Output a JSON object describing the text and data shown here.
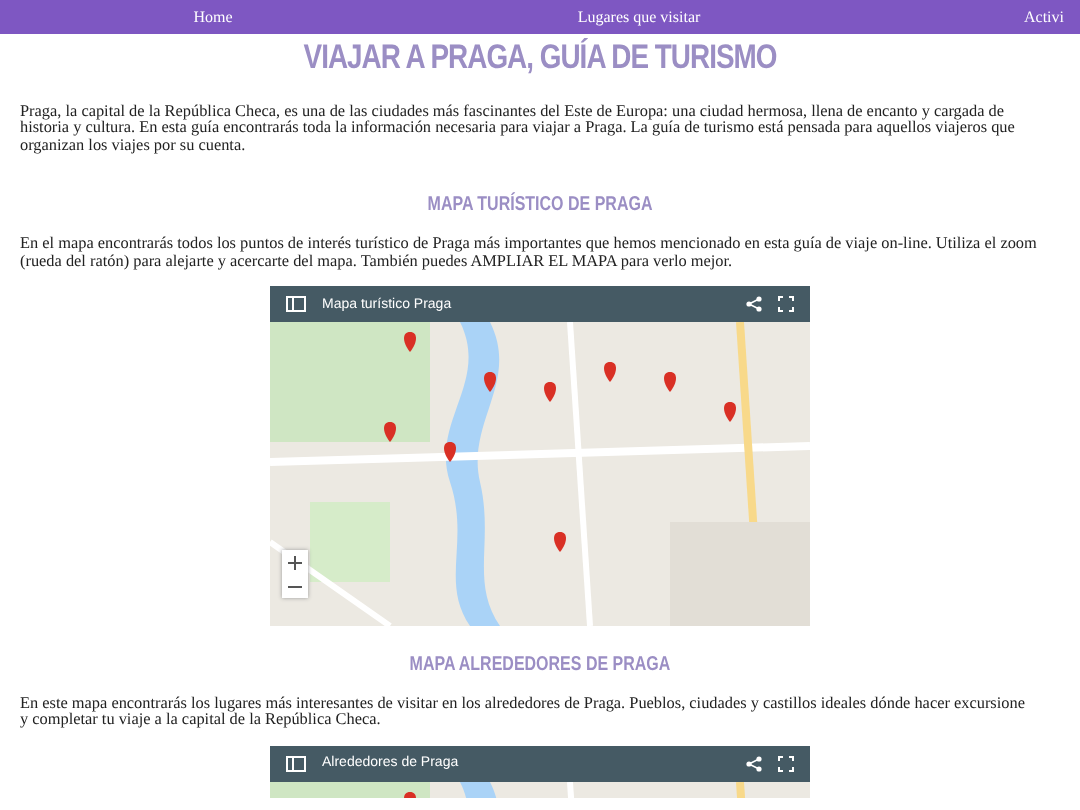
{
  "nav": {
    "items": [
      {
        "label": "Home"
      },
      {
        "label": "Lugares que visitar"
      },
      {
        "label": "Activi"
      }
    ]
  },
  "title": "VIAJAR A PRAGA, GUÍA DE TURISMO",
  "intro": "Praga, la capital de la República Checa, es una de las ciudades más fascinantes del Este de Europa: una ciudad hermosa, llena de encanto y cargada de\nhistoria y cultura. En esta guía encontrarás toda la información necesaria para viajar a Praga. La guía de turismo está pensada para aquellos viajeros que\norganizan los viajes por su cuenta.",
  "sections": [
    {
      "heading": "MAPA TURÍSTICO DE PRAGA",
      "text": "En el mapa encontrarás todos los puntos de interés turístico de Praga más importantes que hemos mencionado en esta guía de viaje on-line. Utiliza el zoom\n(rueda del ratón) para alejarte y acercarte del mapa. También puedes AMPLIAR EL MAPA para verlo mejor.",
      "map": {
        "title": "Mapa turístico Praga",
        "full": true
      }
    },
    {
      "heading": "MAPA ALREDEDORES DE PRAGA",
      "text": "En este mapa encontrarás los lugares más interesantes de visitar en los alrededores de Praga. Pueblos, ciudades y castillos ideales dónde hacer excursione\ny completar tu viaje a la capital de la República Checa.",
      "map": {
        "title": "Alrededores de Praga",
        "full": false
      }
    }
  ]
}
